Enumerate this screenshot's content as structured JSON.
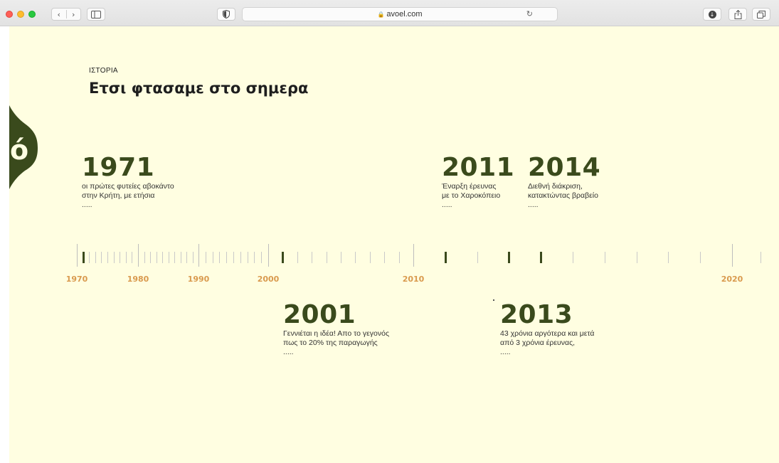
{
  "browser": {
    "url": "avoel.com",
    "icons": {
      "back": "chevron-left-icon",
      "forward": "chevron-right-icon",
      "sidebar": "sidebar-icon",
      "shield": "privacy-shield-icon",
      "lock": "lock-icon",
      "reload": "reload-icon",
      "download": "download-icon",
      "share": "share-icon",
      "tabs": "tab-overview-icon"
    }
  },
  "header": {
    "eyebrow": "ΙΣΤΟΡΙΑ",
    "title": "Ετσι φτασαμε στο σημερα"
  },
  "logo": {
    "glyph": "ό",
    "color": "#3a4a1c"
  },
  "colors": {
    "background": "#fffee1",
    "accent_green": "#3a4a1c",
    "year_label": "#d99a4e"
  },
  "events": {
    "e1971": {
      "year": "1971",
      "line1": "οι πρώτες φυτείες αβοκάντο",
      "line2": "στην Κρήτη, με ετήσια",
      "more": "....."
    },
    "e2011": {
      "year": "2011",
      "line1": "Έναρξη έρευνας",
      "line2": "με το Χαροκόπειο",
      "more": "....."
    },
    "e2014": {
      "year": "2014",
      "line1": "Διεθνή διάκριση,",
      "line2": "κατακτώντας βραβείο",
      "more": "....."
    },
    "e2001": {
      "year": "2001",
      "line1": "Γεννιέται η ιδέα! Απο το γεγονός",
      "line2": "πως το  20% της παραγωγής",
      "more": "....."
    },
    "e2013": {
      "year": "2013",
      "line1": "43 χρόνια αργότερα και μετά",
      "line2": "από 3 χρόνια έρευνας,",
      "more": "....."
    }
  },
  "timeline": {
    "labels": [
      "1970",
      "1980",
      "1990",
      "2000",
      "2010",
      "2020"
    ],
    "highlighted_years": [
      1971,
      2001,
      2011,
      2013,
      2014
    ]
  }
}
